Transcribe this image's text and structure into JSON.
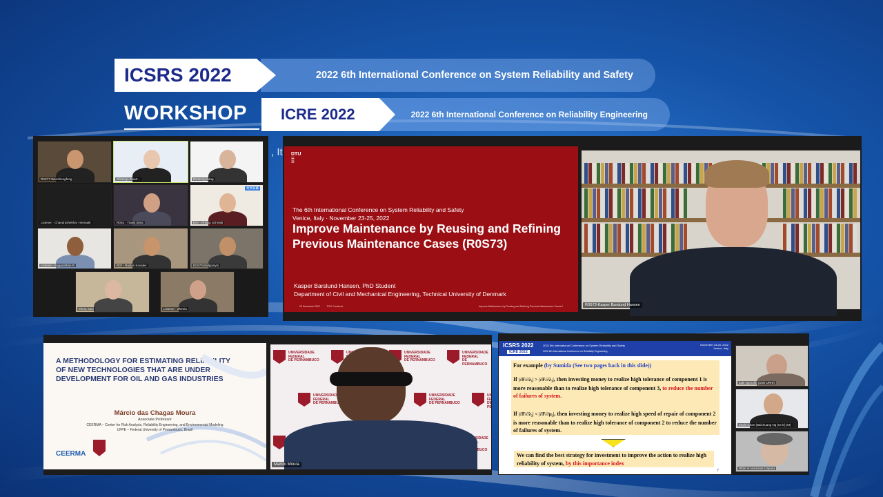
{
  "banner": {
    "icsrs_logo": "ICSRS 2022",
    "icsrs_subtitle": "2022 6th International Conference on System Reliability and Safety",
    "workshop": "WORKSHOP",
    "icre_logo": "ICRE 2022",
    "icre_subtitle": "2022 6th International Conference on Reliability Engineering"
  },
  "gallery": {
    "tiles": [
      {
        "name": "R0S77-Wenshengfeng"
      },
      {
        "name": "Shimeiyi-Stuart..."
      },
      {
        "name": "Eunsung Kang"
      },
      {
        "name": "Listener - Chandrashekhar Hiremath"
      },
      {
        "name": "R0S1 - Travis Sims"
      },
      {
        "name": "R07 - Philipp Schmidt"
      },
      {
        "name": "Listener - Naganathan R"
      },
      {
        "name": "R07 - Ruslan Kovalev"
      },
      {
        "name": "R0S73-Ballgianym"
      },
      {
        "name": "Elena Sarri"
      },
      {
        "name": "Listener - Zhenia"
      }
    ],
    "badge": "共享屏幕"
  },
  "dtu_slide": {
    "logo": "DTU",
    "conference": "The 6th International Conference on System Reliability and Safety",
    "venue": "Venice, Italy · November 23-25, 2022",
    "title": "Improve Maintenance by Reusing and Refining Previous Maintenance Cases (R0S73)",
    "author": "Kasper Barslund Hansen, PhD Student",
    "department": "Department of Civil and Mechanical Engineering, Technical University of Denmark",
    "footer_date": "25 November 2022",
    "footer_org": "DTU Construct",
    "footer_title": "Improve Maintenance by Reusing and Refining Previous Maintenance Cases",
    "footer_page": "2"
  },
  "kasper_video": {
    "name": "R0S73-Kasper Barslund Hansen"
  },
  "methodology_slide": {
    "title": "A METHODOLOGY FOR ESTIMATING RELIABILITY OF NEW TECHNOLOGIES THAT ARE UNDER DEVELOPMENT FOR OIL AND GAS INDUSTRIES",
    "presenter": "Márcio das Chagas Moura",
    "role": "Associate Professor",
    "affiliation1": "CEERMA – Center for Risk Analysis, Reliability Engineering, and Environmental Modeling",
    "affiliation2": "UFPE – Federal University of Pernambuco, Brazil",
    "logo": "CEERMA"
  },
  "marcio_video": {
    "name": "Marcio Moura",
    "university_line1": "UNIVERSIDADE",
    "university_line2": "FEDERAL",
    "university_line3": "DE PERNAMBUCO"
  },
  "sumida_slide": {
    "header_logo": "ICSRS 2022",
    "header_sub_logo": "ICRE 2022",
    "header_title": "2022 6th International Conference on System Reliability and Safety",
    "header_subtitle": "2022 6th International Conference on Reliability Engineering",
    "header_date": "November 23-25, 2022",
    "header_place": "Venice, Italy",
    "line1": "For example",
    "line1_note": "(by Sumida (See two pages back in this slide))",
    "line2a": "If",
    "line2b": ", then investing money to realize high tolerance of component 1 is more reasonable than to realize high tolerance of component 3,",
    "line2_red": "to reduce the number of failures of system.",
    "line3b": ", then investing money to realize high speed of repair of component 2 is more reasonable than to realize high tolerance of component 2 to reduce the number of failures of system.",
    "conclusion": "We can find the best strategy for investment to improve the action to realize high reliability of system,",
    "conclusion_red": "by this importance index",
    "page": "7"
  },
  "side_gallery": [
    {
      "name": "Itaki Ngorokh (Univ URHI)"
    },
    {
      "name": "Kevin Chan (Baichuang Ng (Univ) (M)"
    },
    {
      "name": "Ritter & Associate (Japan)"
    }
  ],
  "stray_text": ", It"
}
